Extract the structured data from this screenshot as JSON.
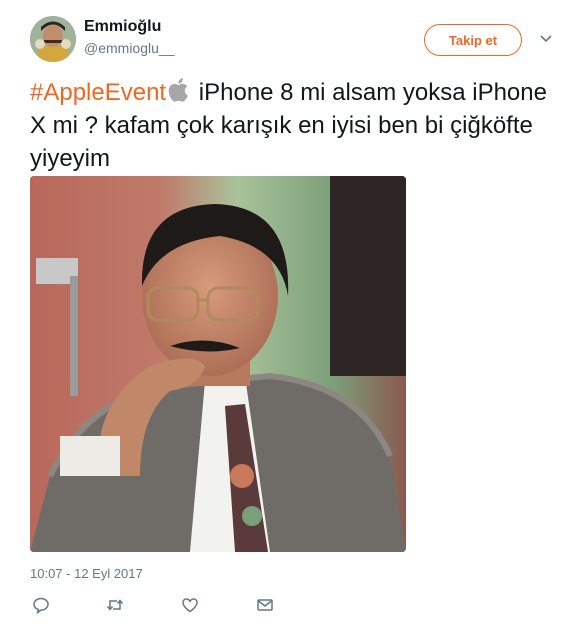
{
  "user": {
    "name": "Emmioğlu",
    "handle": "@emmioglu__"
  },
  "follow_label": "Takip et",
  "tweet": {
    "hashtag": "#AppleEvent",
    "icon": "apple-logo-icon",
    "text": " iPhone 8 mi alsam yoksa iPhone X mi ? kafam çok karışık en iyisi ben bi çiğköfte yiyeyim"
  },
  "timestamp": "10:07 - 12 Eyl 2017",
  "actions": [
    "reply-icon",
    "retweet-icon",
    "like-icon",
    "message-icon"
  ],
  "colors": {
    "accent": "#f26522",
    "muted": "#657786",
    "text": "#14171a"
  }
}
